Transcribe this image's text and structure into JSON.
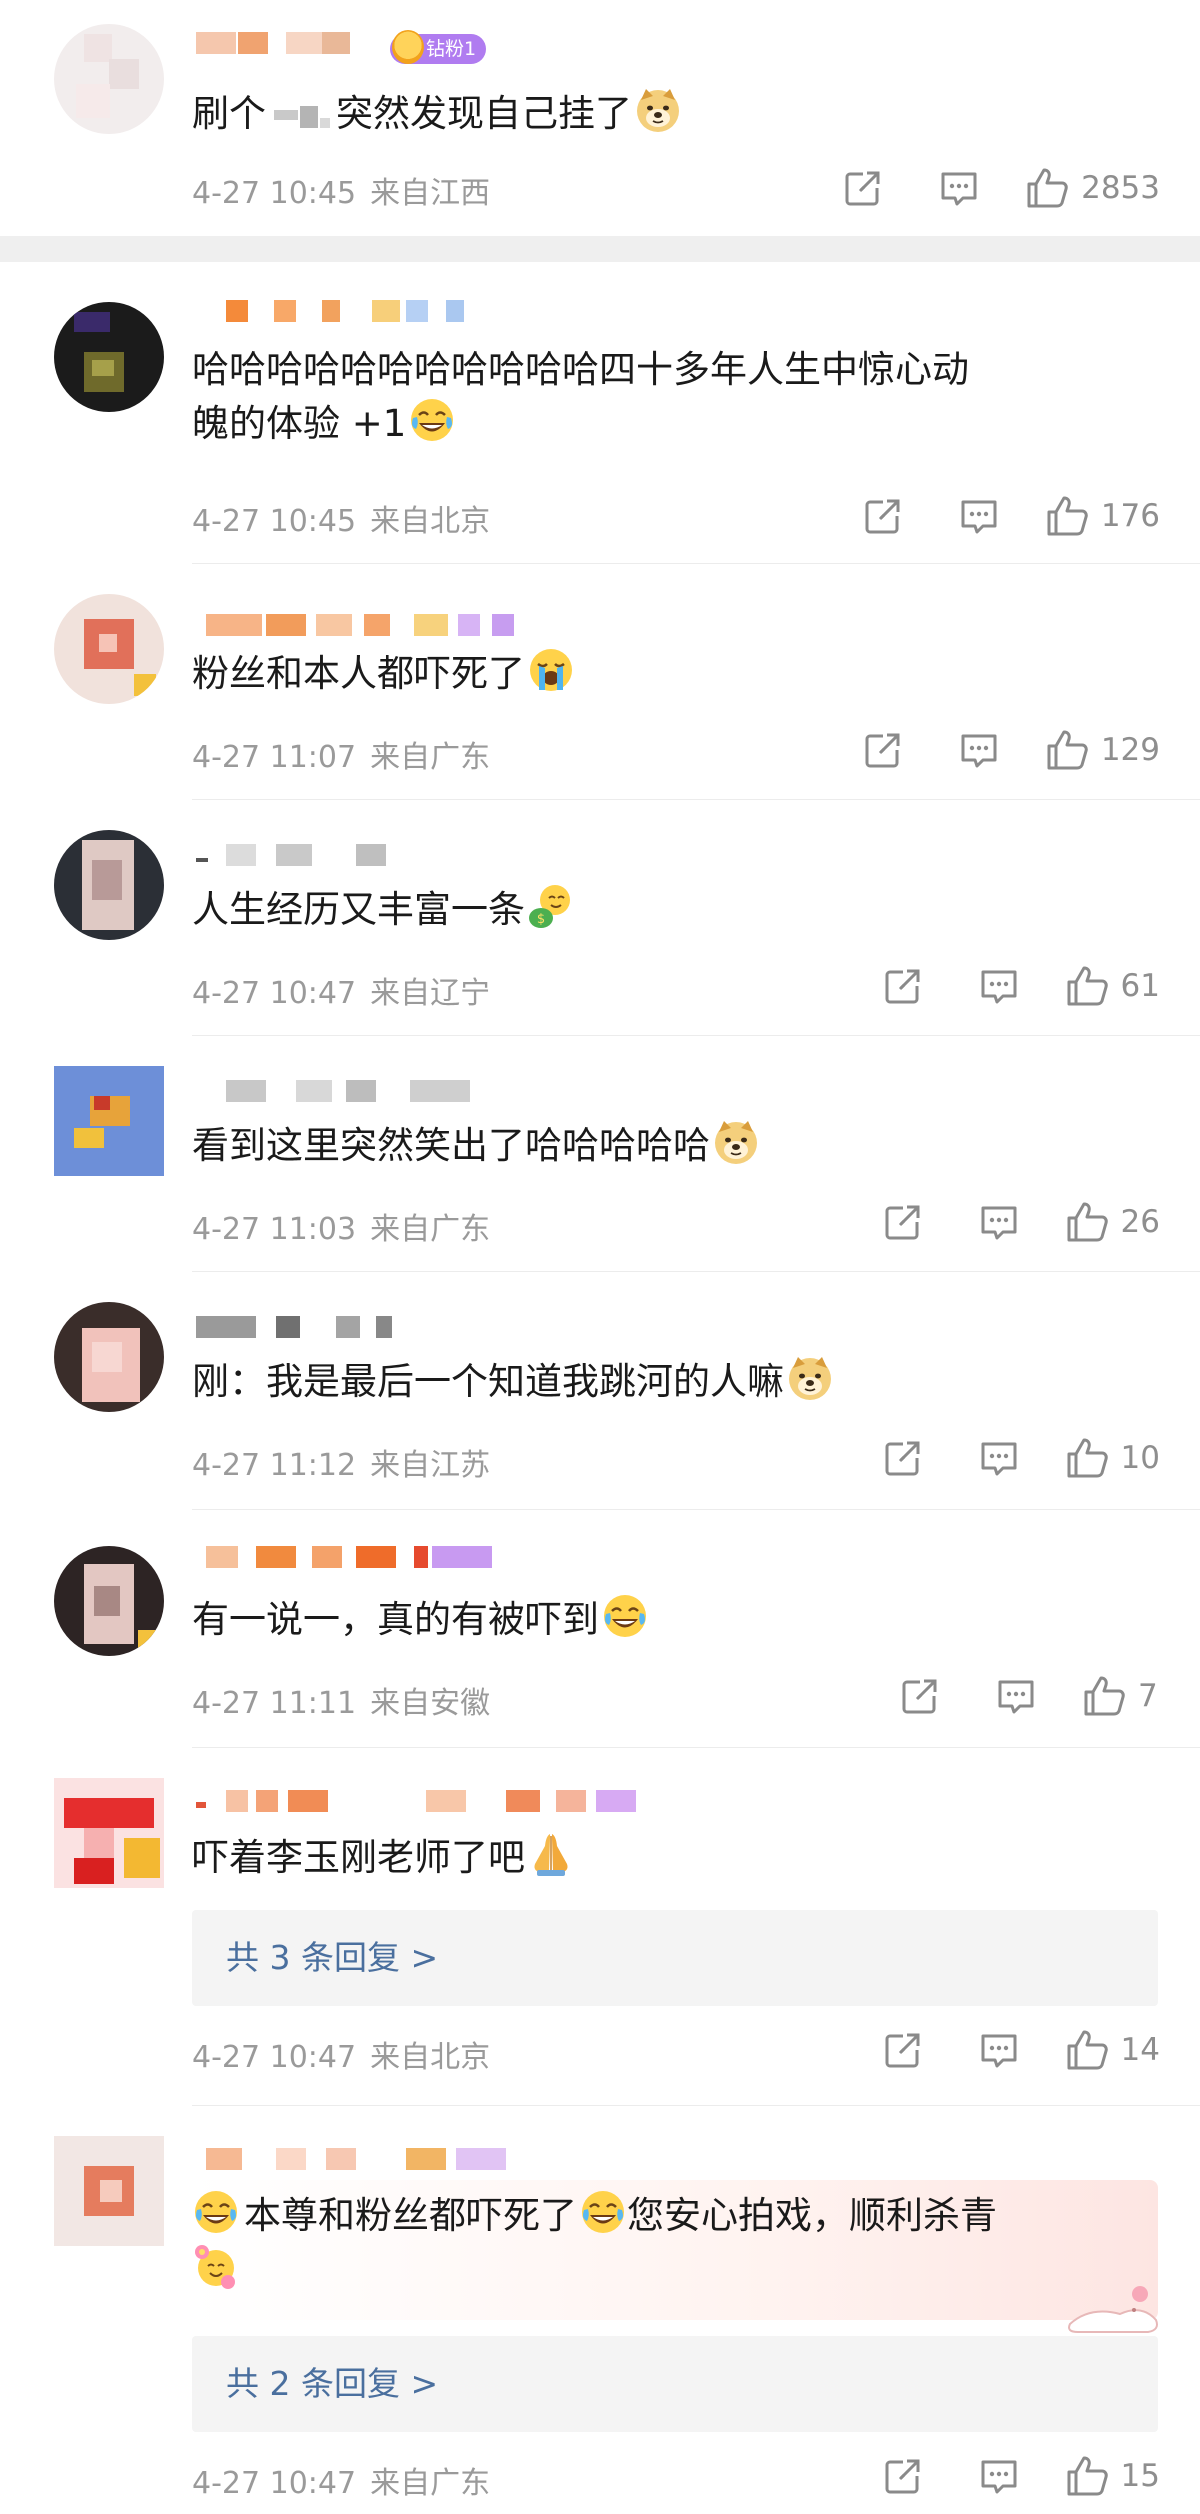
{
  "comments": [
    {
      "text_before": "刷个",
      "text_after": "突然发现自己挂了",
      "emoji": "doge",
      "date": "4-27 10:45",
      "location": "来自江西",
      "likes": "2853",
      "badge": "钻粉1"
    },
    {
      "line1": "哈哈哈哈哈哈哈哈哈哈哈四十多年人生中惊心动",
      "line2": "魄的体验 +1",
      "emoji": "laugh-cry",
      "date": "4-27 10:45",
      "location": "来自北京",
      "likes": "176"
    },
    {
      "text": "粉丝和本人都吓死了",
      "emoji": "crying",
      "date": "4-27 11:07",
      "location": "来自广东",
      "likes": "129"
    },
    {
      "text": "人生经历又丰富一条",
      "emoji": "money-bag",
      "date": "4-27 10:47",
      "location": "来自辽宁",
      "likes": "61"
    },
    {
      "text": "看到这里突然笑出了哈哈哈哈哈",
      "emoji": "doge",
      "date": "4-27 11:03",
      "location": "来自广东",
      "likes": "26"
    },
    {
      "text": "刚：我是最后一个知道我跳河的人嘛",
      "emoji": "doge",
      "date": "4-27 11:12",
      "location": "来自江苏",
      "likes": "10"
    },
    {
      "text": "有一说一，真的有被吓到",
      "emoji": "laugh-cry",
      "date": "4-27 11:11",
      "location": "来自安徽",
      "likes": "7"
    },
    {
      "text": "吓着李玉刚老师了吧",
      "emoji": "pray",
      "replies": "共 3 条回复 >",
      "date": "4-27 10:47",
      "location": "来自北京",
      "likes": "14"
    },
    {
      "text_a": "本尊和粉丝都吓死了",
      "text_b": "您安心拍戏，顺利杀青",
      "emoji": "laugh-cry",
      "emoji_end": "flower-face",
      "replies": "共 2 条回复 >",
      "date": "4-27 10:47",
      "location": "来自广东",
      "likes": "15"
    }
  ],
  "icons": {
    "share": "share-icon",
    "comment": "comment-icon",
    "like": "thumbs-up-icon"
  }
}
